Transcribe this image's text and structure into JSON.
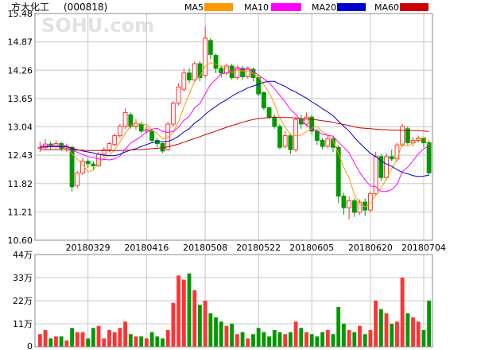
{
  "chart_data": {
    "type": "candlestick",
    "title": "方大化工",
    "code": "(000818)",
    "watermark": "SOHU.com",
    "legend": [
      {
        "name": "MA5",
        "color": "#ff9900"
      },
      {
        "name": "MA10",
        "color": "#ff00ff"
      },
      {
        "name": "MA20",
        "color": "#0000cc"
      },
      {
        "name": "MA60",
        "color": "#cc0000"
      }
    ],
    "price_axis": {
      "ticks": [
        "15.48",
        "14.87",
        "14.26",
        "13.65",
        "13.04",
        "12.43",
        "11.82",
        "11.21",
        "10.60"
      ],
      "ylim": [
        10.6,
        15.48
      ]
    },
    "volume_axis": {
      "ticks": [
        "44万",
        "33万",
        "22万",
        "11万",
        "0"
      ],
      "ylim": [
        0,
        44
      ]
    },
    "date_labels": [
      "20180329",
      "20180416",
      "20180508",
      "20180522",
      "20180605",
      "20180620",
      "20180704"
    ],
    "date_label_index": [
      9,
      20,
      31,
      41,
      51,
      62,
      72
    ],
    "colors": {
      "up": "#ff3333",
      "down": "#009900",
      "grid": "#c8c8c8"
    },
    "candles": [
      [
        12.58,
        12.6,
        12.72,
        12.5
      ],
      [
        12.6,
        12.67,
        12.78,
        12.55
      ],
      [
        12.67,
        12.63,
        12.73,
        12.55
      ],
      [
        12.62,
        12.68,
        12.75,
        12.58
      ],
      [
        12.68,
        12.58,
        12.72,
        12.52
      ],
      [
        12.58,
        12.62,
        12.68,
        12.5
      ],
      [
        12.6,
        11.75,
        12.62,
        11.65
      ],
      [
        11.78,
        12.05,
        12.1,
        11.72
      ],
      [
        12.05,
        12.3,
        12.38,
        12.0
      ],
      [
        12.3,
        12.25,
        12.35,
        12.15
      ],
      [
        12.24,
        12.2,
        12.3,
        12.12
      ],
      [
        12.2,
        12.45,
        12.5,
        12.18
      ],
      [
        12.45,
        12.55,
        12.6,
        12.4
      ],
      [
        12.55,
        12.68,
        12.72,
        12.5
      ],
      [
        12.66,
        12.85,
        12.9,
        12.62
      ],
      [
        12.85,
        13.05,
        13.1,
        12.8
      ],
      [
        13.05,
        13.35,
        13.45,
        13.0
      ],
      [
        13.3,
        13.05,
        13.35,
        13.0
      ],
      [
        13.05,
        13.12,
        13.2,
        12.98
      ],
      [
        13.1,
        12.95,
        13.15,
        12.9
      ],
      [
        12.95,
        12.98,
        13.05,
        12.9
      ],
      [
        12.95,
        12.75,
        13.0,
        12.7
      ],
      [
        12.75,
        12.68,
        12.8,
        12.6
      ],
      [
        12.68,
        12.52,
        12.7,
        12.48
      ],
      [
        12.55,
        13.1,
        13.15,
        12.52
      ],
      [
        13.1,
        13.55,
        13.6,
        13.05
      ],
      [
        13.55,
        13.9,
        13.98,
        13.5
      ],
      [
        13.85,
        14.2,
        14.3,
        13.8
      ],
      [
        14.2,
        14.05,
        14.3,
        13.98
      ],
      [
        14.05,
        14.4,
        14.45,
        14.0
      ],
      [
        14.4,
        14.1,
        14.45,
        14.02
      ],
      [
        14.15,
        14.95,
        15.2,
        14.1
      ],
      [
        14.9,
        14.6,
        14.95,
        14.5
      ],
      [
        14.58,
        14.3,
        14.62,
        14.2
      ],
      [
        14.3,
        14.2,
        14.35,
        14.1
      ],
      [
        14.2,
        14.35,
        14.4,
        14.15
      ],
      [
        14.35,
        14.1,
        14.4,
        14.05
      ],
      [
        14.1,
        14.32,
        14.36,
        14.05
      ],
      [
        14.3,
        14.12,
        14.35,
        14.05
      ],
      [
        14.12,
        14.3,
        14.34,
        14.08
      ],
      [
        14.28,
        14.1,
        14.32,
        14.02
      ],
      [
        14.1,
        13.75,
        14.15,
        13.7
      ],
      [
        13.78,
        13.45,
        13.8,
        13.4
      ],
      [
        13.45,
        13.25,
        13.48,
        13.2
      ],
      [
        13.25,
        13.05,
        13.3,
        13.0
      ],
      [
        13.05,
        12.6,
        13.1,
        12.55
      ],
      [
        12.62,
        12.85,
        12.95,
        12.58
      ],
      [
        12.85,
        12.55,
        12.9,
        12.45
      ],
      [
        12.55,
        13.2,
        13.25,
        12.5
      ],
      [
        13.2,
        13.1,
        13.3,
        13.0
      ],
      [
        13.1,
        13.25,
        13.35,
        13.05
      ],
      [
        13.25,
        12.95,
        13.3,
        12.88
      ],
      [
        12.95,
        12.75,
        13.0,
        12.65
      ],
      [
        12.75,
        12.62,
        12.8,
        12.55
      ],
      [
        12.62,
        12.78,
        12.85,
        12.58
      ],
      [
        12.78,
        12.6,
        12.82,
        12.5
      ],
      [
        12.6,
        11.55,
        12.65,
        11.4
      ],
      [
        11.55,
        11.3,
        11.62,
        11.15
      ],
      [
        11.3,
        11.45,
        11.55,
        11.05
      ],
      [
        11.45,
        11.2,
        11.5,
        11.1
      ],
      [
        11.2,
        11.42,
        11.48,
        11.15
      ],
      [
        11.42,
        11.25,
        11.5,
        11.12
      ],
      [
        11.25,
        11.6,
        11.65,
        11.2
      ],
      [
        11.6,
        12.4,
        12.5,
        11.55
      ],
      [
        12.4,
        11.95,
        12.45,
        11.88
      ],
      [
        11.95,
        12.4,
        12.48,
        11.9
      ],
      [
        12.4,
        12.35,
        12.55,
        12.3
      ],
      [
        12.35,
        12.65,
        12.7,
        12.3
      ],
      [
        12.65,
        13.05,
        13.1,
        12.62
      ],
      [
        13.0,
        12.7,
        13.05,
        12.65
      ],
      [
        12.7,
        12.75,
        12.82,
        12.62
      ],
      [
        12.75,
        12.8,
        12.85,
        12.7
      ],
      [
        12.8,
        12.7,
        12.82,
        12.6
      ],
      [
        12.7,
        12.05,
        12.75,
        12.0
      ]
    ],
    "volumes": [
      6,
      8,
      4,
      5,
      5,
      3,
      9,
      7,
      7,
      4,
      9,
      10,
      4,
      8,
      7,
      9,
      12,
      6,
      5,
      5,
      4,
      7,
      5,
      4,
      8,
      21,
      34,
      32,
      35,
      27,
      20,
      22,
      16,
      14,
      12,
      10,
      11,
      6,
      7,
      4,
      6,
      9,
      7,
      5,
      8,
      7,
      6,
      7,
      12,
      9,
      7,
      6,
      5,
      7,
      8,
      6,
      19,
      11,
      8,
      7,
      10,
      6,
      8,
      22,
      18,
      16,
      11,
      12,
      33,
      16,
      14,
      12,
      8,
      22
    ],
    "ma5": [
      12.62,
      12.63,
      12.63,
      12.64,
      12.63,
      12.64,
      12.46,
      12.34,
      12.23,
      12.07,
      12.11,
      12.25,
      12.37,
      12.43,
      12.55,
      12.72,
      12.9,
      13.06,
      13.12,
      13.1,
      13.09,
      12.97,
      12.9,
      12.78,
      12.81,
      12.92,
      13.16,
      13.47,
      13.74,
      14.02,
      14.13,
      14.34,
      14.42,
      14.39,
      14.35,
      14.31,
      14.21,
      14.26,
      14.24,
      14.24,
      14.19,
      14.12,
      13.95,
      13.77,
      13.54,
      13.22,
      13.04,
      12.86,
      12.85,
      12.86,
      12.94,
      13.01,
      13.05,
      12.93,
      12.87,
      12.74,
      12.47,
      12.17,
      11.94,
      11.58,
      11.38,
      11.32,
      11.38,
      11.57,
      11.72,
      11.92,
      12.14,
      12.34,
      12.68,
      12.62,
      12.7,
      12.79,
      12.8,
      12.64
    ],
    "ma10": [
      12.63,
      12.63,
      12.63,
      12.63,
      12.63,
      12.63,
      12.55,
      12.49,
      12.45,
      12.4,
      12.38,
      12.35,
      12.34,
      12.33,
      12.35,
      12.41,
      12.56,
      12.69,
      12.76,
      12.84,
      12.93,
      12.99,
      13.01,
      12.94,
      12.92,
      12.94,
      13.03,
      13.18,
      13.27,
      13.45,
      13.54,
      13.75,
      13.95,
      14.06,
      14.18,
      14.2,
      14.25,
      14.29,
      14.28,
      14.28,
      14.23,
      14.16,
      14.07,
      13.99,
      13.86,
      13.72,
      13.58,
      13.41,
      13.31,
      13.16,
      13.08,
      13.0,
      12.95,
      12.88,
      12.86,
      12.84,
      12.71,
      12.6,
      12.48,
      12.26,
      12.06,
      11.9,
      11.77,
      11.75,
      11.65,
      11.65,
      11.69,
      11.8,
      12.08,
      12.17,
      12.31,
      12.46,
      12.57,
      12.62
    ],
    "ma20": [
      12.6,
      12.61,
      12.61,
      12.62,
      12.61,
      12.61,
      12.58,
      12.55,
      12.52,
      12.5,
      12.48,
      12.45,
      12.43,
      12.42,
      12.42,
      12.45,
      12.5,
      12.54,
      12.57,
      12.62,
      12.66,
      12.7,
      12.72,
      12.72,
      12.73,
      12.77,
      12.84,
      12.93,
      13.0,
      13.12,
      13.2,
      13.31,
      13.4,
      13.48,
      13.56,
      13.62,
      13.7,
      13.77,
      13.82,
      13.88,
      13.92,
      13.96,
      14.0,
      14.02,
      14.02,
      13.96,
      13.91,
      13.84,
      13.79,
      13.72,
      13.66,
      13.58,
      13.51,
      13.43,
      13.36,
      13.28,
      13.16,
      13.05,
      12.95,
      12.81,
      12.69,
      12.58,
      12.47,
      12.4,
      12.31,
      12.24,
      12.19,
      12.12,
      12.06,
      12.03,
      11.99,
      11.97,
      11.98,
      12.0
    ],
    "ma60": [
      12.55,
      12.55,
      12.55,
      12.55,
      12.55,
      12.55,
      12.54,
      12.54,
      12.54,
      12.53,
      12.53,
      12.53,
      12.53,
      12.53,
      12.53,
      12.53,
      12.54,
      12.54,
      12.55,
      12.55,
      12.56,
      12.57,
      12.58,
      12.59,
      12.61,
      12.64,
      12.67,
      12.71,
      12.75,
      12.79,
      12.83,
      12.87,
      12.91,
      12.95,
      12.99,
      13.03,
      13.07,
      13.1,
      13.14,
      13.17,
      13.2,
      13.22,
      13.23,
      13.24,
      13.25,
      13.24,
      13.24,
      13.24,
      13.23,
      13.22,
      13.21,
      13.2,
      13.19,
      13.17,
      13.16,
      13.14,
      13.11,
      13.09,
      13.07,
      13.04,
      13.02,
      13.01,
      13.0,
      12.99,
      12.98,
      12.98,
      12.97,
      12.97,
      12.97,
      12.96,
      12.96,
      12.96,
      12.95,
      12.94
    ]
  }
}
